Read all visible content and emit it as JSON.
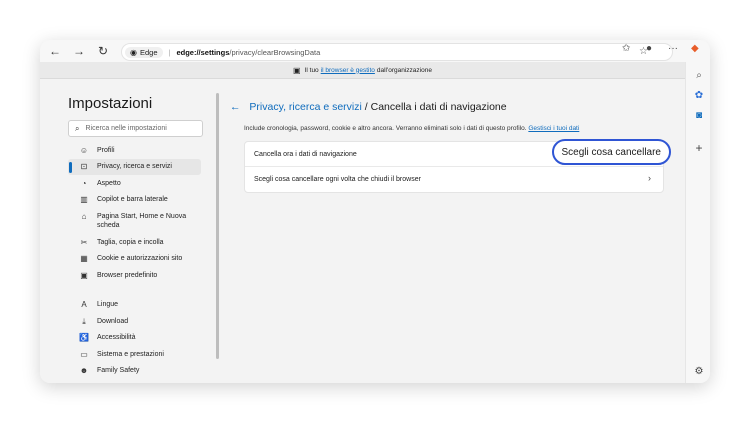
{
  "toolbar": {
    "back": "←",
    "forward": "→",
    "refresh": "↻",
    "edge_label": "Edge",
    "url_bold": "edge://settings",
    "url_rest": "/privacy/clearBrowsingData",
    "menu": "···"
  },
  "banner": {
    "prefix": "Il tuo",
    "link": "il browser è gestito",
    "suffix": "dall'organizzazione"
  },
  "sidebar": {
    "title": "Impostazioni",
    "search_placeholder": "Ricerca nelle impostazioni",
    "items": [
      {
        "label": "Profili",
        "icon": "☺"
      },
      {
        "label": "Privacy, ricerca e servizi",
        "icon": "🔒",
        "active": true
      },
      {
        "label": "Aspetto",
        "icon": "◔"
      },
      {
        "label": "Copilot e barra laterale",
        "icon": "▥"
      },
      {
        "label": "Pagina Start, Home e Nuova scheda",
        "icon": "⌂"
      },
      {
        "label": "Taglia, copia e incolla",
        "icon": "✂"
      },
      {
        "label": "Cookie e autorizzazioni sito",
        "icon": "▦"
      },
      {
        "label": "Browser predefinito",
        "icon": "▣"
      },
      {
        "label": "Lingue",
        "icon": "A"
      },
      {
        "label": "Download",
        "icon": "⤓"
      },
      {
        "label": "Accessibilità",
        "icon": "♿"
      },
      {
        "label": "Sistema e prestazioni",
        "icon": "▭"
      },
      {
        "label": "Family Safety",
        "icon": "☻"
      }
    ]
  },
  "main": {
    "back_arrow": "←",
    "crumb_link": "Privacy, ricerca e servizi",
    "crumb_sep": "/",
    "crumb_current": "Cancella i dati di navigazione",
    "description": "Include cronologia, password, cookie e altro ancora. Verranno eliminati solo i dati di questo profilo.",
    "manage_link": "Gestisci i tuoi dati",
    "row1_label": "Cancella ora i dati di navigazione",
    "row1_button": "Scegli cosa cancellare",
    "row2_label": "Scegli cosa cancellare ogni volta che chiudi il browser",
    "row2_chevron": "›"
  },
  "rail": {
    "add": "+",
    "settings": "⚙"
  }
}
